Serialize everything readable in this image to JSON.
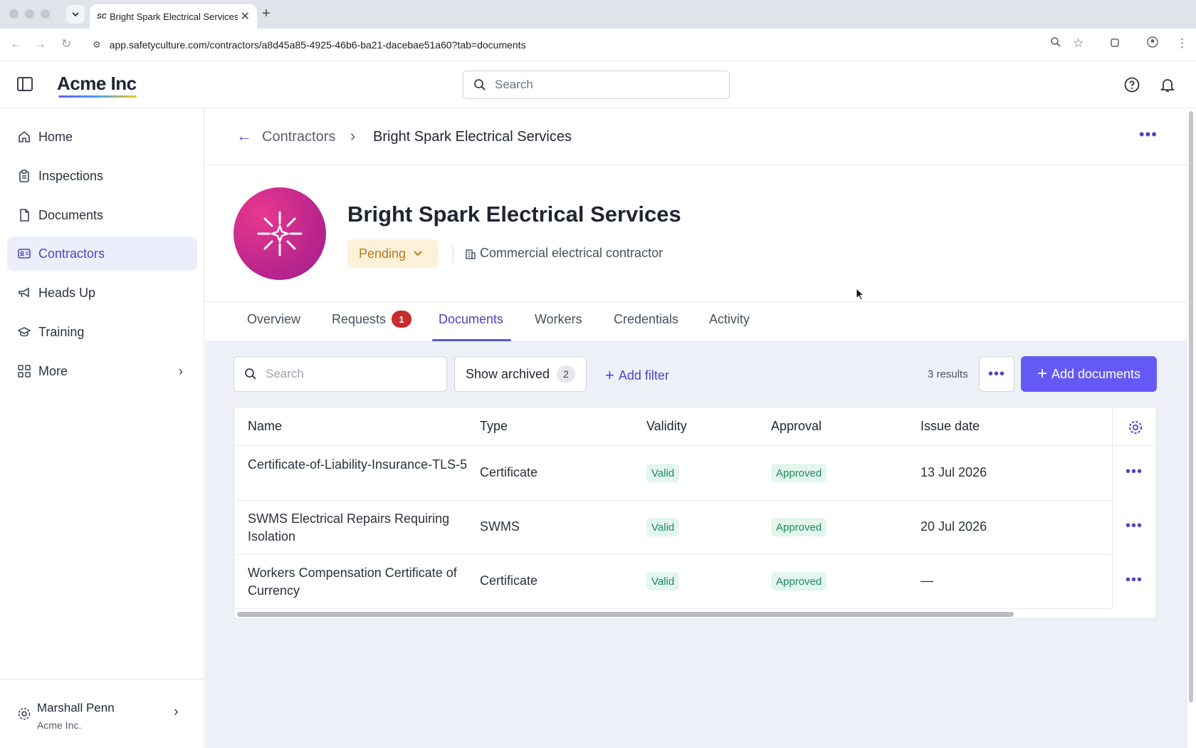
{
  "browser": {
    "tab_title": "Bright Spark Electrical Services",
    "tab_favicon": "SC",
    "url": "app.safetyculture.com/contractors/a8d45a85-4925-46b6-ba21-dacebae51a60?tab=documents"
  },
  "app": {
    "logo": "Acme Inc",
    "search_placeholder": "Search"
  },
  "sidebar": {
    "items": [
      {
        "label": "Home",
        "icon": "home-icon"
      },
      {
        "label": "Inspections",
        "icon": "clipboard-icon"
      },
      {
        "label": "Documents",
        "icon": "document-icon"
      },
      {
        "label": "Contractors",
        "icon": "contractor-card-icon",
        "active": true
      },
      {
        "label": "Heads Up",
        "icon": "megaphone-icon"
      },
      {
        "label": "Training",
        "icon": "graduation-cap-icon"
      },
      {
        "label": "More",
        "icon": "grid-icon"
      }
    ],
    "user": {
      "name": "Marshall Penn",
      "org": "Acme Inc."
    }
  },
  "breadcrumb": {
    "parent": "Contractors",
    "current": "Bright Spark Electrical Services"
  },
  "contractor": {
    "name": "Bright Spark Electrical Services",
    "status": "Pending",
    "type": "Commercial electrical contractor"
  },
  "tabs": [
    {
      "label": "Overview"
    },
    {
      "label": "Requests",
      "badge": "1"
    },
    {
      "label": "Documents",
      "active": true
    },
    {
      "label": "Workers"
    },
    {
      "label": "Credentials"
    },
    {
      "label": "Activity"
    }
  ],
  "toolbar": {
    "search_placeholder": "Search",
    "show_archived_label": "Show archived",
    "archived_count": "2",
    "add_filter_label": "Add filter",
    "results_text": "3 results",
    "add_documents_label": "Add documents"
  },
  "table": {
    "columns": [
      "Name",
      "Type",
      "Validity",
      "Approval",
      "Issue date"
    ],
    "rows": [
      {
        "name": "Certificate-of-Liability-Insurance-TLS-5",
        "type": "Certificate",
        "validity": "Valid",
        "approval": "Approved",
        "issue_date": "13 Jul 2026"
      },
      {
        "name": "SWMS Electrical Repairs Requiring Isolation",
        "type": "SWMS",
        "validity": "Valid",
        "approval": "Approved",
        "issue_date": "20 Jul 2026"
      },
      {
        "name": "Workers Compensation Certificate of Currency",
        "type": "Certificate",
        "validity": "Valid",
        "approval": "Approved",
        "issue_date": "—"
      }
    ]
  },
  "colors": {
    "accent": "#6559f6",
    "status_pending_bg": "#fdf2d9",
    "status_pending_text": "#b7791f",
    "valid_bg": "#e3f6ed",
    "valid_text": "#1d8a5c"
  }
}
